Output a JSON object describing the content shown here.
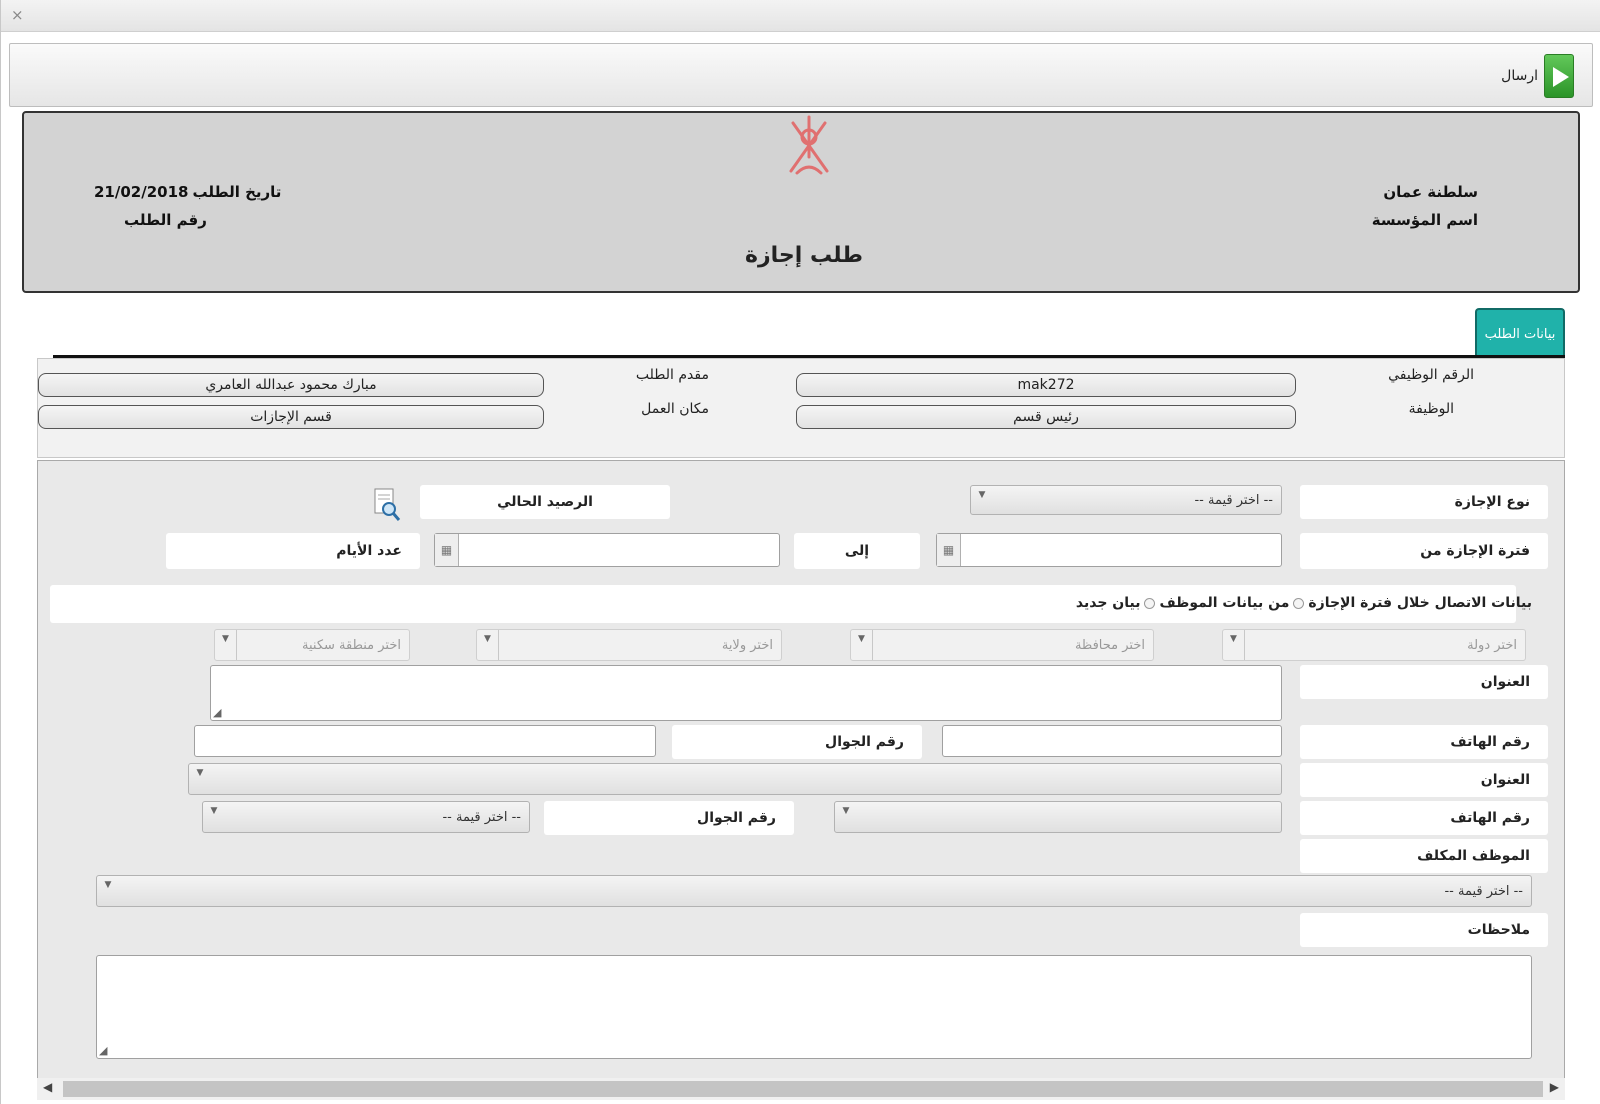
{
  "window": {
    "close_glyph": "×"
  },
  "toolbar": {
    "send_label": "ارسال"
  },
  "header": {
    "country": "سلطنة عمان",
    "org_label": "اسم المؤسسة",
    "title": "طلب إجازة",
    "request_date_label": "تاريخ الطلب",
    "request_date_value": "21/02/2018",
    "request_number_label": "رقم الطلب"
  },
  "tabs": [
    {
      "label": "بيانات الطلب"
    }
  ],
  "employee_info": {
    "employee_no_label": "الرقم الوظيفي",
    "employee_no_value": "mak272",
    "applicant_label": "مقدم الطلب",
    "applicant_value": "مبارك محمود عبدالله العامري",
    "job_label": "الوظيفة",
    "job_value": "رئيس قسم",
    "workplace_label": "مكان العمل",
    "workplace_value": "قسم الإجازات"
  },
  "leave": {
    "type_label": "نوع الإجازة",
    "type_placeholder": "-- اختر قيمة --",
    "balance_label": "الرصيد الحالي",
    "period_from_label": "فترة الإجازة من",
    "to_label": "إلى",
    "days_label": "عدد الأيام"
  },
  "contact": {
    "section_label": "بيانات الاتصال خلال فترة الإجازة",
    "option_employee": "من بيانات الموظف",
    "option_new": "بيان جديد",
    "country_placeholder": "اختر دولة",
    "governorate_placeholder": "اختر محافظة",
    "wilayat_placeholder": "اختر ولاية",
    "area_placeholder": "اختر منطقة سكنية",
    "address_label": "العنوان",
    "phone_label": "رقم الهاتف",
    "mobile_label": "رقم الجوال"
  },
  "delegate": {
    "address_label": "العنوان",
    "phone_label": "رقم الهاتف",
    "mobile_label": "رقم الجوال",
    "mobile_placeholder": "-- اختر قيمة --",
    "assigned_label": "الموظف المكلف",
    "assigned_placeholder": "-- اختر قيمة --",
    "notes_label": "ملاحظات"
  },
  "icons": {
    "close": "close-icon",
    "send": "play-arrow-icon",
    "emblem": "oman-emblem-icon",
    "search": "document-search-icon",
    "calendar": "calendar-icon",
    "dropdown": "dropdown-arrow-icon"
  },
  "colors": {
    "tab_bg": "#20b2aa",
    "send_green": "#2b9428",
    "header_bg": "#d3d3d3"
  }
}
